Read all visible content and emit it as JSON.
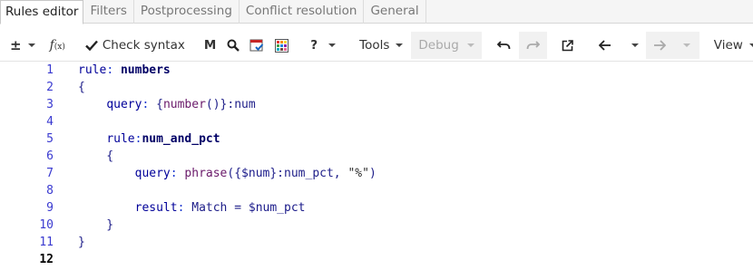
{
  "tabs": [
    {
      "label": "Rules editor",
      "active": true
    },
    {
      "label": "Filters",
      "active": false
    },
    {
      "label": "Postprocessing",
      "active": false
    },
    {
      "label": "Conflict resolution",
      "active": false
    },
    {
      "label": "General",
      "active": false
    }
  ],
  "toolbar": {
    "plus_minus": "±",
    "function_icon": "function-icon",
    "check_syntax": "Check syntax",
    "m_label": "M",
    "help": "?",
    "tools": "Tools",
    "debug": "Debug",
    "view": "View"
  },
  "editor": {
    "line_numbers": [
      "1",
      "2",
      "3",
      "4",
      "5",
      "6",
      "7",
      "8",
      "9",
      "10",
      "11",
      "12"
    ],
    "current_line": 12,
    "lines": [
      "rule: numbers",
      "{",
      "    query: {number()}:num",
      "",
      "    rule:num_and_pct",
      "    {",
      "        query: phrase({$num}:num_pct, \"%\")",
      "",
      "        result: Match = $num_pct",
      "    }",
      "}",
      ""
    ]
  }
}
